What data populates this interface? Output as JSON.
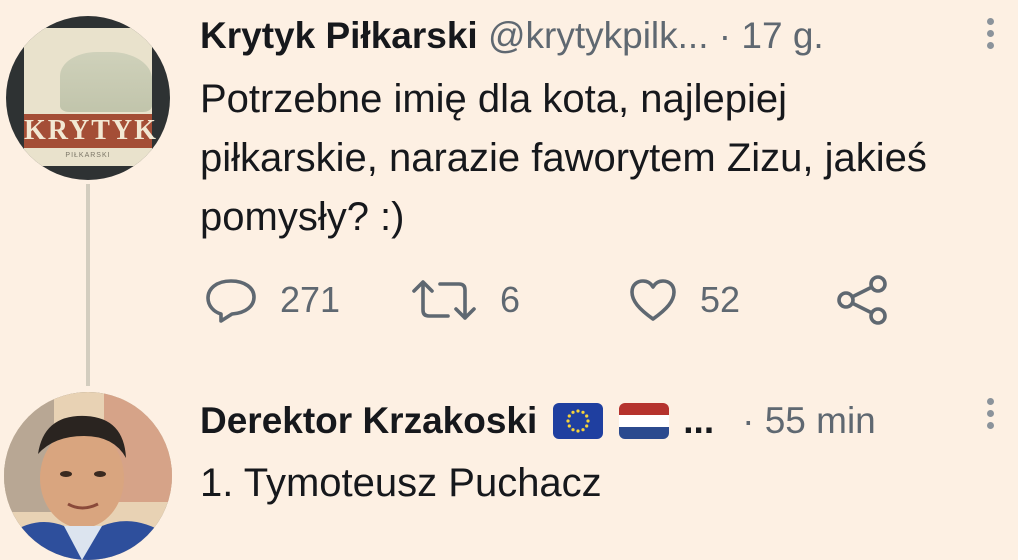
{
  "tweet1": {
    "display_name": "Krytyk Piłkarski",
    "handle": "@krytykpilk...",
    "timestamp": "· 17 g.",
    "text": "Potrzebne imię dla kota, najlepiej\npiłkarskie, narazie faworytem Zizu, jakieś\npomysły? :)",
    "avatar_label": "KRYTYK",
    "avatar_sublabel": "PIŁKARSKI",
    "reply_count": "271",
    "retweet_count": "6",
    "like_count": "52"
  },
  "tweet2": {
    "display_name": "Derektor Krzakoski",
    "name_suffix": "...",
    "timestamp": "· 55 min",
    "text": "1. Tymoteusz Puchacz",
    "flags": [
      "eu-flag",
      "netherlands-flag"
    ]
  },
  "colors": {
    "background": "#fdf0e3",
    "text_primary": "#16181c",
    "text_secondary": "#5f6871"
  }
}
